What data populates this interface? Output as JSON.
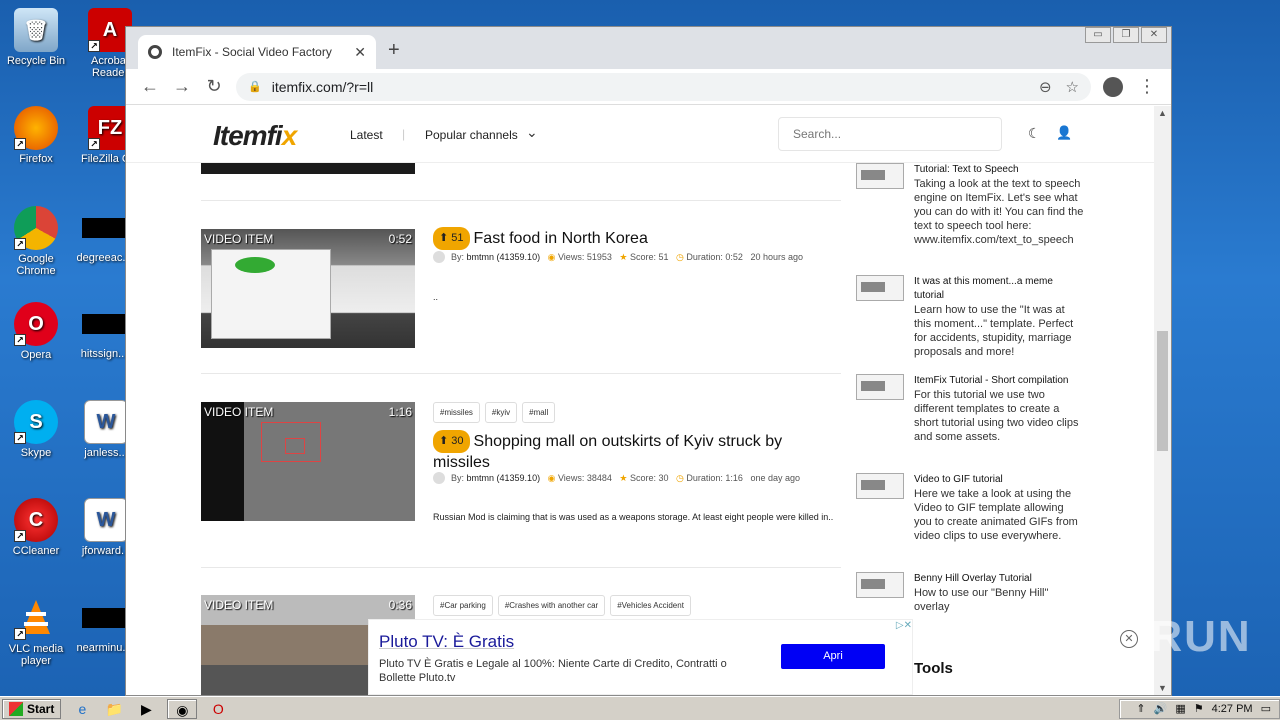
{
  "desktop": {
    "icons": [
      {
        "label": "Recycle Bin",
        "icon": "recycle-bin-icon"
      },
      {
        "label": "Acrobat Reader",
        "icon": "acrobat-icon"
      },
      {
        "label": "Firefox",
        "icon": "firefox-icon"
      },
      {
        "label": "FileZilla C...",
        "icon": "filezilla-icon"
      },
      {
        "label": "Google Chrome",
        "icon": "chrome-icon"
      },
      {
        "label": "degreeac...",
        "icon": "file-icon"
      },
      {
        "label": "Opera",
        "icon": "opera-icon"
      },
      {
        "label": "hitssign...",
        "icon": "file-icon"
      },
      {
        "label": "Skype",
        "icon": "skype-icon"
      },
      {
        "label": "janless...",
        "icon": "word-icon"
      },
      {
        "label": "CCleaner",
        "icon": "ccleaner-icon"
      },
      {
        "label": "jforward...",
        "icon": "word-icon"
      },
      {
        "label": "VLC media player",
        "icon": "vlc-icon"
      },
      {
        "label": "nearminu...",
        "icon": "file-icon"
      }
    ]
  },
  "browser": {
    "tab_title": "ItemFix - Social Video Factory",
    "tab_close": "✕",
    "new_tab": "+",
    "url": "itemfix.com/?r=ll",
    "window_buttons": [
      "▭",
      "❐",
      "✕"
    ]
  },
  "site": {
    "logo": "Itemfi",
    "logo_x": "x",
    "nav_latest": "Latest",
    "nav_popular": "Popular channels",
    "search_placeholder": "Search...",
    "videos": [
      {
        "label": "VIDEO ITEM",
        "duration": "0:52",
        "score": "51",
        "title": "Fast food in North Korea",
        "by": "By:",
        "author": "bmtmn (41359.10)",
        "views": "Views: 51953",
        "score_text": "Score: 51",
        "duration_text": "Duration: 0:52",
        "ago": "20 hours ago",
        "desc": ".."
      },
      {
        "label": "VIDEO ITEM",
        "duration": "1:16",
        "tags": [
          "#missiles",
          "#kyiv",
          "#mall"
        ],
        "score": "30",
        "title": "Shopping mall on outskirts of Kyiv struck by missiles",
        "by": "By:",
        "author": "bmtmn (41359.10)",
        "views": "Views: 38484",
        "score_text": "Score: 30",
        "duration_text": "Duration: 1:16",
        "ago": "one day ago",
        "desc": "Russian Mod is claiming that is was used as a weapons storage. At least eight people were killed in.."
      },
      {
        "label": "VIDEO ITEM",
        "duration": "0:36",
        "tags": [
          "#Car parking",
          "#Crashes with another car",
          "#Vehicles Accident"
        ]
      }
    ],
    "sidebar": [
      {
        "title": "Tutorial: Text to Speech",
        "text": "Taking a look at the text to speech engine on ItemFix. Let's see what you can do with it! You can find the text to speech tool here: www.itemfix.com/text_to_speech"
      },
      {
        "title": "It was at this moment...a meme tutorial",
        "text": "Learn how to use the \"It was at this moment...\" template. Perfect for accidents, stupidity, marriage proposals and more!"
      },
      {
        "title": "ItemFix Tutorial - Short compilation",
        "text": "For this tutorial we use two different templates to create a short tutorial using two video clips and some assets."
      },
      {
        "title": "Video to GIF tutorial",
        "text": "Here we take a look at using the Video to GIF template allowing you to create animated GIFs from video clips to use everywhere."
      },
      {
        "title": "Benny Hill Overlay Tutorial",
        "text": "How to use our \"Benny Hill\" overlay"
      }
    ],
    "tools_heading": "Tools"
  },
  "ad": {
    "title": "Pluto TV: È Gratis",
    "desc": "Pluto TV È Gratis e Legale al 100%: Niente Carte di Credito, Contratti o Bollette Pluto.tv",
    "button": "Apri",
    "close": "▷✕"
  },
  "watermark": "ANY RUN",
  "taskbar": {
    "start": "Start",
    "time": "4:27 PM"
  }
}
